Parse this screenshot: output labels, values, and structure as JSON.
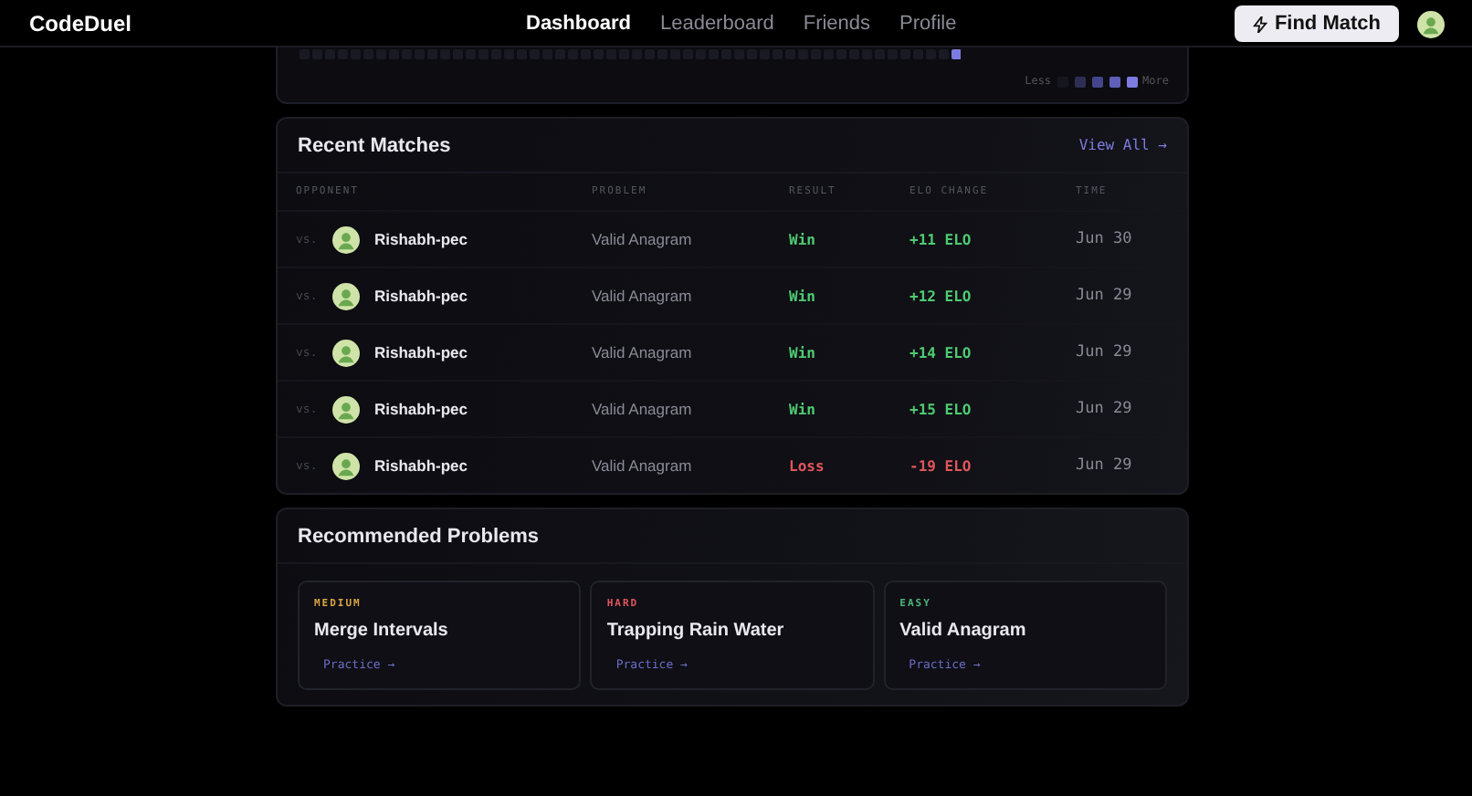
{
  "header": {
    "logo": "CodeDuel",
    "nav": [
      {
        "label": "Dashboard",
        "selected": true
      },
      {
        "label": "Leaderboard",
        "selected": false
      },
      {
        "label": "Friends",
        "selected": false
      },
      {
        "label": "Profile",
        "selected": false
      }
    ],
    "action": "Find Match"
  },
  "activity": {
    "legend_less": "Less",
    "legend_more": "More"
  },
  "recent_matches": {
    "title": "Recent Matches",
    "view_all": "View All →",
    "columns": [
      "OPPONENT",
      "PROBLEM",
      "RESULT",
      "ELO CHANGE",
      "TIME"
    ],
    "rows": [
      {
        "vs": "vs.",
        "opponent": "Rishabh-pec",
        "problem": "Valid Anagram",
        "result": "Win",
        "kind": "win",
        "elo": "+11 ELO",
        "time": "Jun 30"
      },
      {
        "vs": "vs.",
        "opponent": "Rishabh-pec",
        "problem": "Valid Anagram",
        "result": "Win",
        "kind": "win",
        "elo": "+12 ELO",
        "time": "Jun 29"
      },
      {
        "vs": "vs.",
        "opponent": "Rishabh-pec",
        "problem": "Valid Anagram",
        "result": "Win",
        "kind": "win",
        "elo": "+14 ELO",
        "time": "Jun 29"
      },
      {
        "vs": "vs.",
        "opponent": "Rishabh-pec",
        "problem": "Valid Anagram",
        "result": "Win",
        "kind": "win",
        "elo": "+15 ELO",
        "time": "Jun 29"
      },
      {
        "vs": "vs.",
        "opponent": "Rishabh-pec",
        "problem": "Valid Anagram",
        "result": "Loss",
        "kind": "loss",
        "elo": "-19 ELO",
        "time": "Jun 29"
      }
    ]
  },
  "recommended": {
    "title": "Recommended Problems",
    "problems": [
      {
        "difficulty": "MEDIUM",
        "color": "#d9a441",
        "name": "Merge Intervals",
        "action": "Practice →"
      },
      {
        "difficulty": "HARD",
        "color": "#e0565b",
        "name": "Trapping Rain Water",
        "action": "Practice →"
      },
      {
        "difficulty": "EASY",
        "color": "#4fb37a",
        "name": "Valid Anagram",
        "action": "Practice →"
      }
    ]
  }
}
